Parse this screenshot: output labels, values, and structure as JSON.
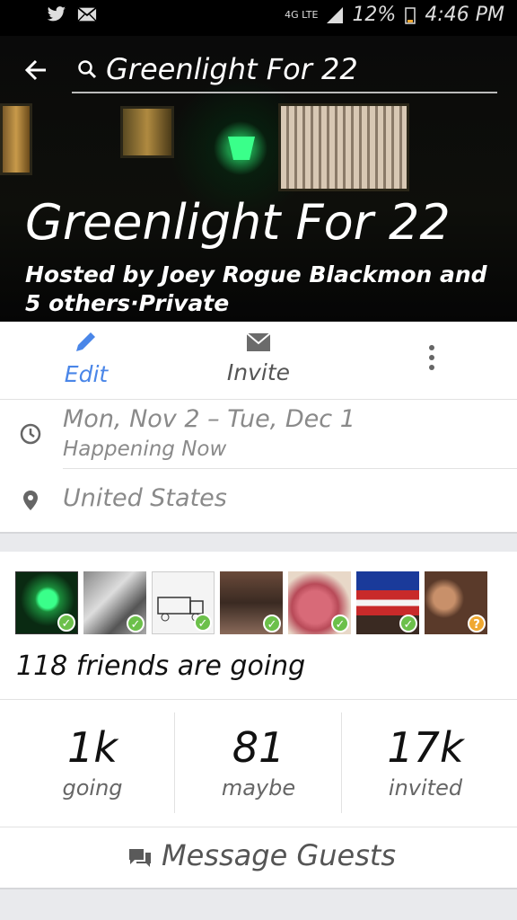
{
  "status_bar": {
    "network": "4G LTE",
    "battery": "12%",
    "time": "4:46 PM",
    "notification_icons": [
      "twitter-icon",
      "mail-icon"
    ]
  },
  "search": {
    "query": "Greenlight For 22"
  },
  "event": {
    "title": "Greenlight For 22",
    "hosted_by": "Hosted by Joey Rogue Blackmon and 5 others·Private"
  },
  "actions": {
    "edit_label": "Edit",
    "invite_label": "Invite"
  },
  "details": {
    "date_range": "Mon, Nov 2 – Tue, Dec 1",
    "status": "Happening Now",
    "location": "United States"
  },
  "friends": {
    "going_text": "118 friends are going",
    "avatars": [
      {
        "status": "going"
      },
      {
        "status": "going"
      },
      {
        "status": "going"
      },
      {
        "status": "going"
      },
      {
        "status": "going"
      },
      {
        "status": "going"
      },
      {
        "status": "maybe"
      }
    ]
  },
  "stats": {
    "going_count": "1k",
    "going_label": "going",
    "maybe_count": "81",
    "maybe_label": "maybe",
    "invited_count": "17k",
    "invited_label": "invited"
  },
  "message_guests": "Message Guests",
  "colors": {
    "accent": "#4a86e8",
    "going_badge": "#6cc04a",
    "maybe_badge": "#f0a830",
    "muted_text": "#8a8a8a"
  }
}
